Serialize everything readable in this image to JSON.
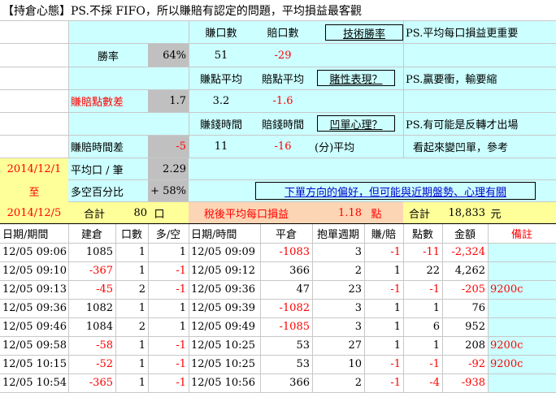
{
  "title": "【持倉心態】PS.不採 FIFO，所以賺賠有認定的問題，平均損益最客觀",
  "summary": {
    "win_count_label": "賺口數",
    "lose_count_label": "賠口數",
    "btn_skill_winrate": "技術勝率",
    "note1": "PS.平均每口損益更重要",
    "winrate_label": "勝率",
    "winrate_value": "64%",
    "win_count": "51",
    "lose_count": "-29",
    "win_pts_avg_label": "賺點平均",
    "lose_pts_avg_label": "賠點平均",
    "btn_performance": "賭性表現？",
    "note2": "PS.贏要衝，輸要縮",
    "pts_diff_label": "賺賠點數差",
    "pts_diff_value": "1.7",
    "win_pts_avg": "3.2",
    "lose_pts_avg": "-1.6",
    "win_time_label": "賺錢時間",
    "lose_time_label": "賠錢時間",
    "btn_psych": "凹單心理？",
    "note3": "PS.有可能是反轉才出場",
    "time_diff_label": "賺賠時間差",
    "time_diff_value": "-5",
    "win_time": "11",
    "lose_time": "-16",
    "minute_avg": "(分)平均",
    "note4": "看起來變凹單，參考",
    "date_from": "2014/12/1",
    "to_label": "至",
    "date_to": "2014/12/5",
    "avg_per_lot_label": "平均口 / 筆",
    "avg_per_lot_value": "2.29",
    "long_short_label": "多空百分比",
    "long_short_value": "+ 58%",
    "link_bias": "下單方向的偏好，但可能與近期盤勢、心理有關",
    "total_label": "合計",
    "total_lots": "80",
    "lot_unit": "口",
    "after_tax_label": "稅後平均每口損益",
    "after_tax_value": "1.18",
    "point_unit": "點",
    "total_label2": "合計",
    "total_amount": "18,833",
    "currency_unit": "元"
  },
  "table": {
    "headers": [
      "日期/期間",
      "建倉",
      "口數",
      "多/空",
      "日期/時間",
      "平倉",
      "抱單週期",
      "賺/賠",
      "點數",
      "金額",
      "備註"
    ],
    "rows": [
      [
        "12/05 09:06",
        "1085",
        "1",
        "1",
        "12/05 09:09",
        "-1083",
        "3",
        "-1",
        "-11",
        "-2,324",
        ""
      ],
      [
        "12/05 09:10",
        "-367",
        "1",
        "-1",
        "12/05 09:12",
        "366",
        "2",
        "1",
        "22",
        "4,262",
        ""
      ],
      [
        "12/05 09:13",
        "-45",
        "2",
        "-1",
        "12/05 09:36",
        "47",
        "23",
        "-1",
        "-1",
        "-205",
        "9200c"
      ],
      [
        "12/05 09:36",
        "1082",
        "1",
        "1",
        "12/05 09:39",
        "-1082",
        "3",
        "1",
        "1",
        "76",
        ""
      ],
      [
        "12/05 09:46",
        "1084",
        "2",
        "1",
        "12/05 09:49",
        "-1085",
        "3",
        "1",
        "6",
        "952",
        ""
      ],
      [
        "12/05 09:58",
        "-58",
        "1",
        "-1",
        "12/05 10:25",
        "53",
        "27",
        "1",
        "1",
        "208",
        "9200c"
      ],
      [
        "12/05 10:15",
        "-52",
        "1",
        "-1",
        "12/05 10:25",
        "53",
        "10",
        "-1",
        "-1",
        "-92",
        "9200c"
      ],
      [
        "12/05 10:54",
        "-365",
        "1",
        "-1",
        "12/05 10:56",
        "366",
        "2",
        "-1",
        "-4",
        "-938",
        ""
      ]
    ]
  }
}
